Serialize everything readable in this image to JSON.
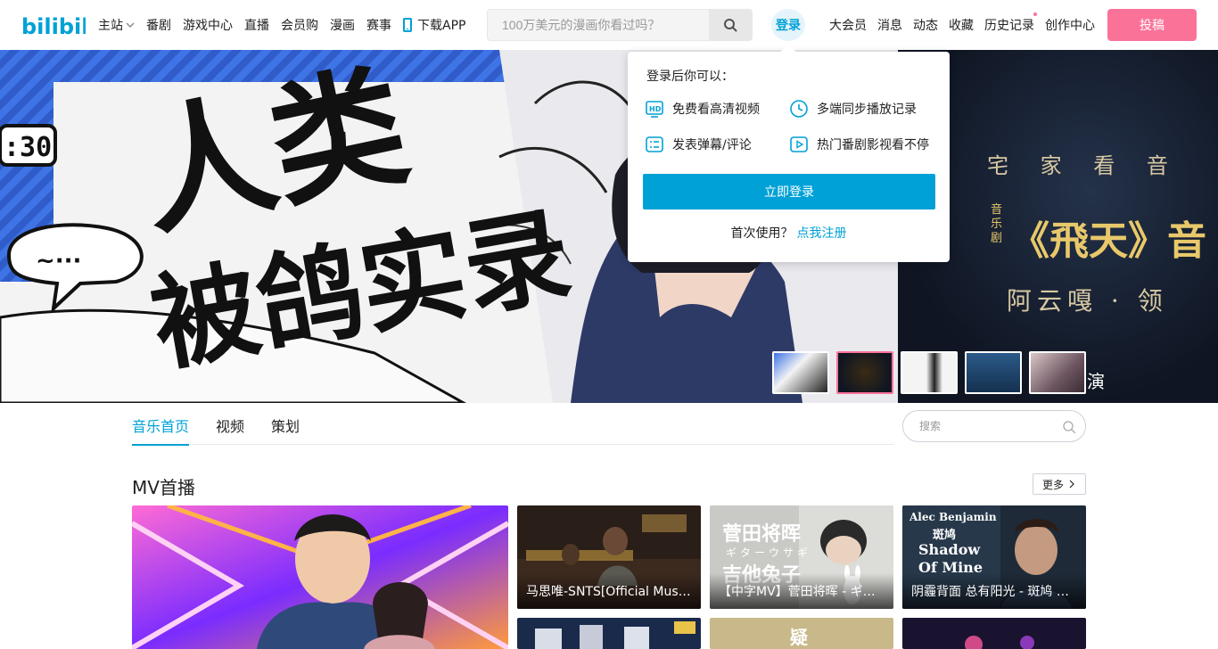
{
  "header": {
    "logo_text": "bilibili",
    "nav_left": [
      "主站",
      "番剧",
      "游戏中心",
      "直播",
      "会员购",
      "漫画",
      "赛事"
    ],
    "download_app": "下载APP",
    "search_placeholder": "100万美元的漫画你看过吗？",
    "login": "登录",
    "nav_right": [
      "大会员",
      "消息",
      "动态",
      "收藏",
      "历史记录",
      "创作中心"
    ],
    "upload": "投稿"
  },
  "banner": {
    "main_title_line1": "人类",
    "main_title_line2": "被鸽实录",
    "clock": ":30",
    "side_line1": "宅 家 看 音",
    "side_title": "《飛天》音",
    "side_badge": "音乐剧",
    "side_line3": "阿云嘎 · 领",
    "overlay_text": "演"
  },
  "login_popup": {
    "title": "登录后你可以：",
    "features": [
      "免费看高清视频",
      "多端同步播放记录",
      "发表弹幕/评论",
      "热门番剧影视看不停"
    ],
    "login_button": "立即登录",
    "register_prompt": "首次使用？",
    "register_link": "点我注册"
  },
  "tabs": [
    "音乐首页",
    "视频",
    "策划"
  ],
  "sub_search_placeholder": "搜索",
  "section": {
    "title": "MV首播",
    "more": "更多"
  },
  "cards": [
    {
      "caption": "马思唯-SNTS[Official Music Video]"
    },
    {
      "caption": "【中字MV】菅田将晖 - ギターウサギ"
    },
    {
      "caption": "阴霾背面 总有阳光 - 斑鸠 Alec Benjamin"
    }
  ],
  "covers": {
    "card2_line1": "菅田将晖",
    "card2_line2": "ギターウサギ",
    "card2_line3": "吉他兔子",
    "card3_line1": "Alec Benjamin",
    "card3_line2": "斑鸠",
    "card3_line3": "Shadow",
    "card3_line4": "Of Mine",
    "card5_text": "疑"
  },
  "colors": {
    "brand_blue": "#00a1d6",
    "brand_pink": "#fb7299"
  }
}
